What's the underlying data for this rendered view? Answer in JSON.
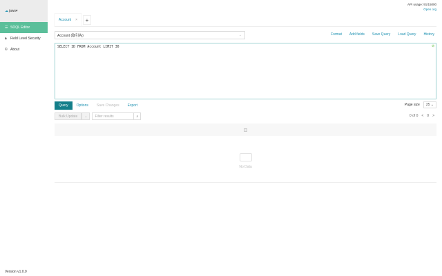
{
  "sidebar": {
    "user": "jaws",
    "items": [
      {
        "label": "SOQL Editor",
        "icon": "database-icon",
        "active": true
      },
      {
        "label": "Field Level Security",
        "icon": "lock-icon",
        "active": false
      },
      {
        "label": "About",
        "icon": "copyright-icon",
        "active": false
      }
    ],
    "version": "Version v1.0.0"
  },
  "header": {
    "api_usage": "API usage: 91/15000",
    "open_org": "Open org"
  },
  "tabs": [
    {
      "label": "Account",
      "close": "×"
    }
  ],
  "add_tab": "+",
  "object_select": "Account (取引先)",
  "actions": [
    "Format",
    "Add fields",
    "Save Query",
    "Load Query",
    "History"
  ],
  "editor": {
    "query": "SELECT ID FROM Account LIMIT 30"
  },
  "query_tabs": [
    {
      "label": "Query",
      "state": "active"
    },
    {
      "label": "Options",
      "state": "normal"
    },
    {
      "label": "Save Changes",
      "state": "disabled"
    },
    {
      "label": "Export",
      "state": "normal"
    }
  ],
  "page_size": {
    "label": "Page size",
    "value": "25"
  },
  "toolbar": {
    "bulk_update": "Bulk Update",
    "filter_placeholder": "Filter results"
  },
  "pager": {
    "range": "0 of 0",
    "page": "0",
    "prev": "<",
    "next": ">"
  },
  "grid": {
    "empty": "No Data"
  },
  "colors": {
    "accent": "#1a8fb0",
    "sidebar_active": "#5bbf9a",
    "query_button": "#147f8a"
  }
}
